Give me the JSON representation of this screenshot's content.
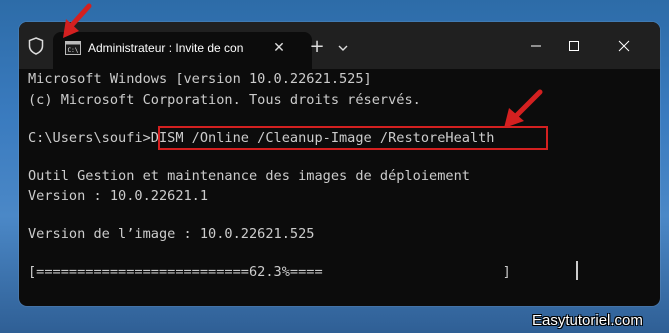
{
  "window": {
    "tab_title": "Administrateur : Invite de con",
    "tab_icon": "cmd-icon",
    "new_tab_label": "+",
    "close_tab_label": "✕"
  },
  "terminal": {
    "lines": [
      "Microsoft Windows [version 10.0.22621.525]",
      "(c) Microsoft Corporation. Tous droits réservés.",
      "C:\\Users\\soufi>DISM /Online /Cleanup-Image /RestoreHealth",
      "Outil Gestion et maintenance des images de déploiement",
      "Version : 10.0.22621.1",
      "Version de l’image : 10.0.22621.525",
      "[==========================62.3%====                      ]"
    ],
    "progress_percent": 62.3
  },
  "annotations": {
    "highlight_color": "#d42020"
  },
  "watermark": "Easytutoriel.com"
}
